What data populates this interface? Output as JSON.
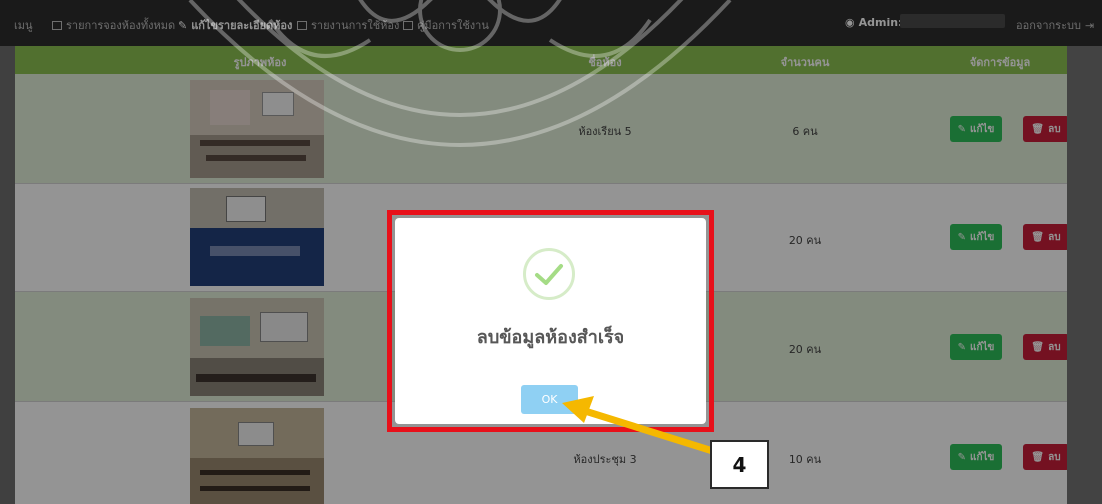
{
  "navbar": {
    "menu": "เมนู",
    "items": [
      {
        "label": "รายการจองห้องทั้งหมด"
      },
      {
        "label": "แก้ไขรายละเอียดห้อง"
      },
      {
        "label": "รายงานการใช้ห้อง"
      },
      {
        "label": "คู่มือการใช้งาน"
      }
    ],
    "admin_label": "Admin:",
    "logout": "ออกจากระบบ"
  },
  "table": {
    "headers": [
      "รูปภาพห้อง",
      "ชื่อห้อง",
      "จำนวนคน",
      "จัดการข้อมูล"
    ],
    "rows": [
      {
        "name": "ห้องเรียน 5",
        "capacity": "6 คน"
      },
      {
        "name": "",
        "capacity": "20 คน"
      },
      {
        "name": "",
        "capacity": "20 คน"
      },
      {
        "name": "ห้องประชุม 3",
        "capacity": "10 คน"
      }
    ],
    "edit_label": "แก้ไข",
    "delete_label": "ลบ"
  },
  "modal": {
    "title": "ลบข้อมูลห้องสำเร็จ",
    "ok_label": "OK"
  },
  "annotation": {
    "step": "4"
  },
  "colors": {
    "header_green": "#8cc152",
    "edit_green": "#2ec05a",
    "delete_red": "#c81e3a",
    "highlight_red": "#e8101a",
    "arrow_yellow": "#f5b800",
    "ok_blue": "#8fd0f3"
  }
}
